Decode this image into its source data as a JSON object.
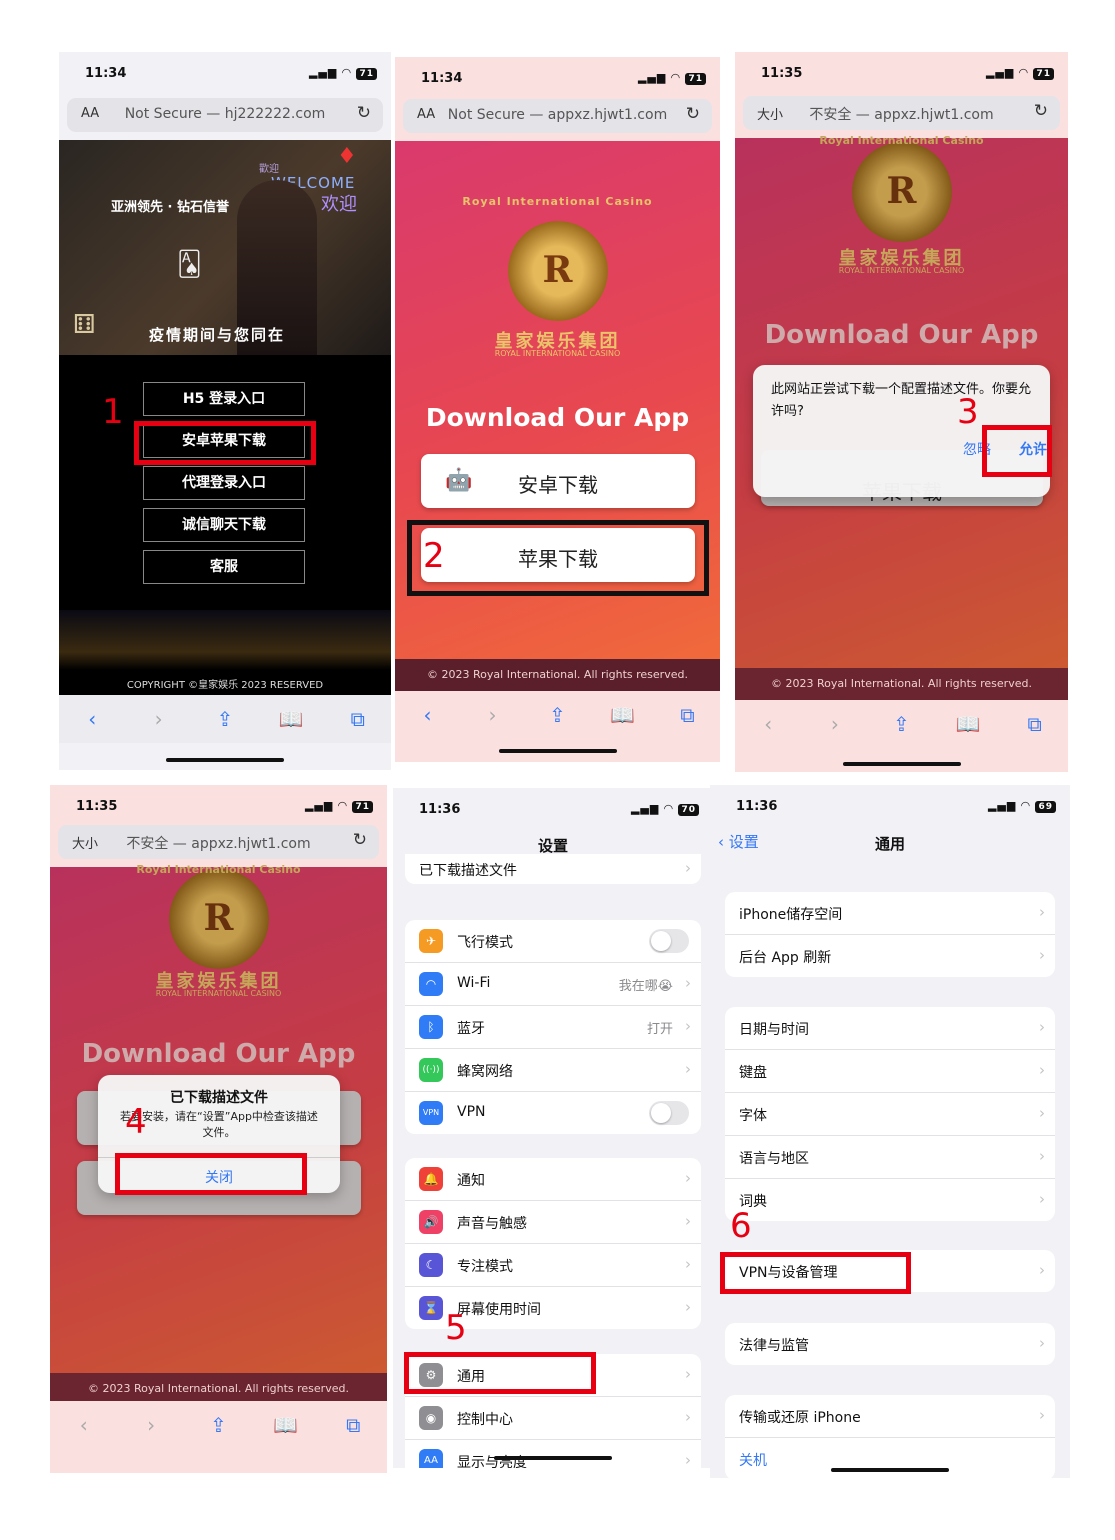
{
  "p1": {
    "time": "11:34",
    "battery": "71",
    "url_aa": "AA",
    "url": "Not Secure — hj222222.com",
    "brand": "亚洲领先 · 钻石信誉",
    "welcome": "WELCOME",
    "welcome_cn": "欢迎",
    "welcome_small": "歡迎",
    "tagline": "疫情期间与您同在",
    "menu": [
      "H5 登录入口",
      "安卓苹果下载",
      "代理登录入口",
      "诚信聊天下载",
      "客服"
    ],
    "copyright": "COPYRIGHT ©皇家娱乐 2023 RESERVED",
    "step": "1"
  },
  "p2": {
    "time": "11:34",
    "battery": "71",
    "url_aa": "AA",
    "url": "Not Secure — appxz.hjwt1.com",
    "crest_letter": "R",
    "arc": "Royal International Casino",
    "brand_cn": "皇家娱乐集团",
    "brand_en": "ROYAL INTERNATIONAL CASINO",
    "heading": "Download Our App",
    "android": "安卓下载",
    "apple": "苹果下载",
    "copyright": "© 2023 Royal International. All rights reserved.",
    "step": "2"
  },
  "p3": {
    "time": "11:35",
    "battery": "71",
    "url_aa": "大小",
    "url": "不安全 — appxz.hjwt1.com",
    "crest_letter": "R",
    "arc": "Royal International Casino",
    "brand_cn": "皇家娱乐集团",
    "brand_en": "ROYAL INTERNATIONAL CASINO",
    "heading": "Download Our App",
    "dialog_text": "此网站正尝试下载一个配置描述文件。你要允许吗?",
    "ignore": "忽略",
    "allow": "允许",
    "apple_partial": "苹果下载",
    "copyright": "© 2023 Royal International. All rights reserved.",
    "step": "3"
  },
  "p4": {
    "time": "11:35",
    "battery": "71",
    "url_aa": "大小",
    "url": "不安全 — appxz.hjwt1.com",
    "crest_letter": "R",
    "arc": "Royal International Casino",
    "brand_cn": "皇家娱乐集团",
    "brand_en": "ROYAL INTERNATIONAL CASINO",
    "heading": "Download Our App",
    "dialog_title": "已下载描述文件",
    "dialog_text": "若要安装，请在“设置”App中检查该描述文件。",
    "close": "关闭",
    "copyright": "© 2023 Royal International. All rights reserved.",
    "step": "4"
  },
  "p5": {
    "time": "11:36",
    "battery": "70",
    "title": "设置",
    "profile_row": "已下载描述文件",
    "rows1": [
      {
        "label": "飞行模式",
        "icon": "✈",
        "color": "#f59a23"
      },
      {
        "label": "Wi-Fi",
        "icon": "◠",
        "color": "#2f7cf6",
        "value": "我在哪😭"
      },
      {
        "label": "蓝牙",
        "icon": "ᛒ",
        "color": "#2f7cf6",
        "value": "打开"
      },
      {
        "label": "蜂窝网络",
        "icon": "((·))",
        "color": "#34c759"
      },
      {
        "label": "VPN",
        "icon": "VPN",
        "color": "#2f7cf6"
      }
    ],
    "rows2": [
      {
        "label": "通知",
        "icon": "🔔",
        "color": "#ef4137"
      },
      {
        "label": "声音与触感",
        "icon": "🔊",
        "color": "#ef4166"
      },
      {
        "label": "专注模式",
        "icon": "☾",
        "color": "#5856d6"
      },
      {
        "label": "屏幕使用时间",
        "icon": "⌛",
        "color": "#5856d6"
      }
    ],
    "rows3": [
      {
        "label": "通用",
        "icon": "⚙",
        "color": "#8e8e93"
      },
      {
        "label": "控制中心",
        "icon": "◉",
        "color": "#8e8e93"
      },
      {
        "label": "显示与亮度",
        "icon": "AA",
        "color": "#2f7cf6"
      }
    ],
    "step": "5"
  },
  "p6": {
    "time": "11:36",
    "battery": "69",
    "back": "设置",
    "title": "通用",
    "g1": [
      "iPhone储存空间",
      "后台 App 刷新"
    ],
    "g2": [
      "日期与时间",
      "键盘",
      "字体",
      "语言与地区",
      "词典"
    ],
    "g3": [
      "VPN与设备管理"
    ],
    "g4": [
      "法律与监管"
    ],
    "g5": [
      "传输或还原 iPhone"
    ],
    "shutdown": "关机",
    "step": "6"
  },
  "colors": {
    "accent_red": "#e60012",
    "ios_blue": "#3478f6"
  }
}
